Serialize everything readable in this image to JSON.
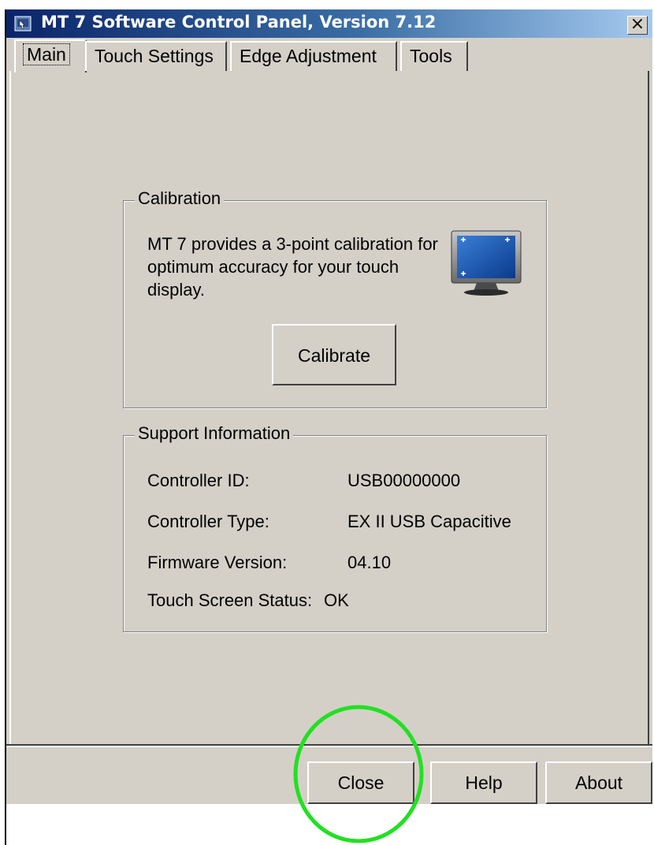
{
  "window": {
    "title": "MT 7 Software Control Panel, Version 7.12",
    "close_glyph": "×"
  },
  "tabs": [
    {
      "label": "Main",
      "selected": true
    },
    {
      "label": "Touch Settings",
      "selected": false
    },
    {
      "label": "Edge Adjustment",
      "selected": false
    },
    {
      "label": "Tools",
      "selected": false
    }
  ],
  "calibration": {
    "group_label": "Calibration",
    "description": "MT 7 provides a 3-point calibration for optimum accuracy for your touch display.",
    "button_label": "Calibrate",
    "icon": "monitor-calibration-icon"
  },
  "support": {
    "group_label": "Support Information",
    "rows": [
      {
        "label": "Controller ID:",
        "value": "USB00000000"
      },
      {
        "label": "Controller Type:",
        "value": "EX II USB Capacitive"
      },
      {
        "label": "Firmware Version:",
        "value": "04.10"
      },
      {
        "label": "Touch Screen Status:",
        "value": "OK"
      }
    ]
  },
  "buttons": {
    "close": "Close",
    "help": "Help",
    "about": "About"
  },
  "colors": {
    "titlebar_start": "#0a246a",
    "titlebar_end": "#a6caf0",
    "dialog_bg": "#d4d0c8",
    "highlight": "#22e022"
  }
}
